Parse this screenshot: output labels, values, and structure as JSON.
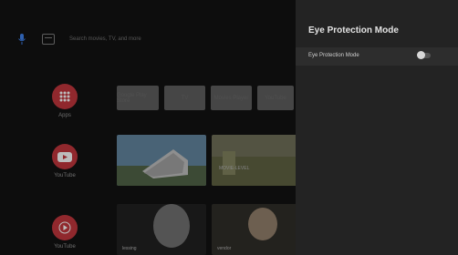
{
  "search": {
    "placeholder": "Search movies, TV, and more"
  },
  "rows": {
    "apps": "Apps",
    "youtube": "YouTube",
    "youtube2": "YouTube"
  },
  "app_tiles": [
    "Google Play Store",
    "TV",
    "Movies Player",
    "YouTube"
  ],
  "thumb_captions": {
    "mid": "MOVIE-LEVEL",
    "b1": "lessing",
    "b2": "vendor"
  },
  "panel": {
    "title": "Eye Protection Mode",
    "setting_label": "Eye Protection Mode",
    "toggle_state": "off"
  },
  "colors": {
    "accent": "#b8333a",
    "panel_bg": "#232323"
  }
}
